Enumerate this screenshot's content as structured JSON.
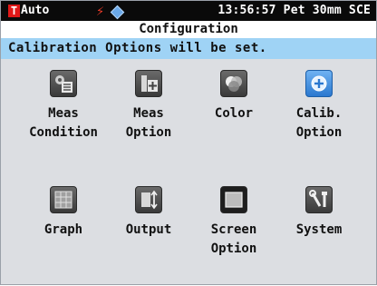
{
  "status": {
    "mode": "Auto",
    "time": "13:56:57",
    "target": "Pet 30mm SCE"
  },
  "header": {
    "title": "Configuration",
    "message": "Calibration Options will be set."
  },
  "menu": {
    "items": [
      {
        "label": "Meas\nCondition",
        "icon": "meas-condition-icon"
      },
      {
        "label": "Meas\nOption",
        "icon": "meas-option-icon"
      },
      {
        "label": "Color",
        "icon": "color-icon"
      },
      {
        "label": "Calib.\nOption",
        "icon": "calib-option-icon",
        "selected": true
      },
      {
        "label": "Graph",
        "icon": "graph-icon"
      },
      {
        "label": "Output",
        "icon": "output-icon"
      },
      {
        "label": "Screen\nOption",
        "icon": "screen-option-icon"
      },
      {
        "label": "System",
        "icon": "system-icon"
      }
    ]
  },
  "colors": {
    "status_bg": "#0a0a0a",
    "message_bg": "#9fd3f5",
    "screen_bg": "#dcdee2",
    "selected_icon": "#3d8fe0"
  }
}
